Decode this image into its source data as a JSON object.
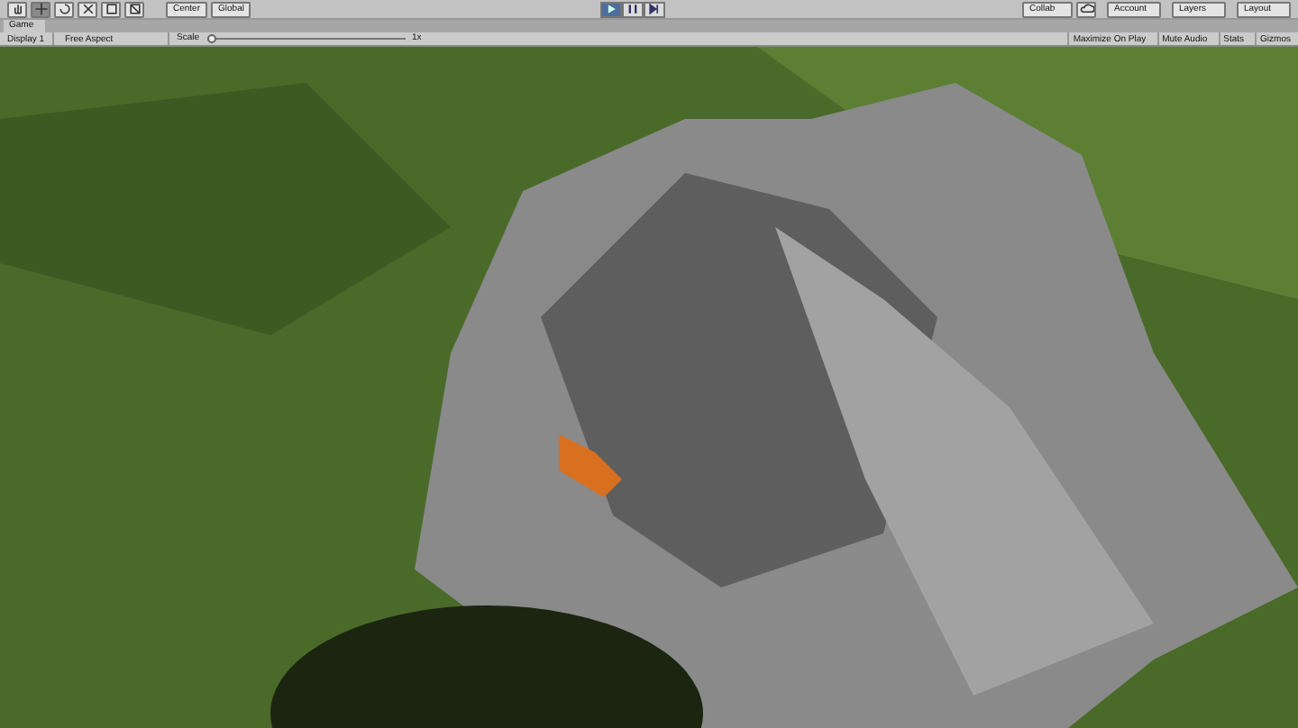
{
  "toolbar": {
    "tools": [
      {
        "kind": "hand",
        "selected": false
      },
      {
        "kind": "move",
        "selected": true
      },
      {
        "kind": "rotate",
        "selected": false
      },
      {
        "kind": "scale",
        "selected": false
      },
      {
        "kind": "rect",
        "selected": false
      },
      {
        "kind": "transform",
        "selected": false
      }
    ],
    "pivot": [
      {
        "label": "Center"
      },
      {
        "label": "Global"
      }
    ],
    "playback": [
      {
        "kind": "play",
        "selected": true
      },
      {
        "kind": "pause",
        "selected": false
      },
      {
        "kind": "step",
        "selected": false
      }
    ],
    "collab": "Collab",
    "account": "Account",
    "layers": "Layers",
    "layout": "Layout"
  },
  "tab": {
    "title": "Game"
  },
  "game_bar": {
    "display": "Display 1",
    "aspect": "Free Aspect",
    "scale_label": "Scale",
    "scale": {
      "level": 0.0
    },
    "scale_reading": "1x",
    "toggles": [
      {
        "label": "Maximize On Play",
        "on": false
      },
      {
        "label": "Mute Audio",
        "on": false
      },
      {
        "label": "Stats",
        "on": false
      }
    ],
    "gizmos": "Gizmos"
  }
}
